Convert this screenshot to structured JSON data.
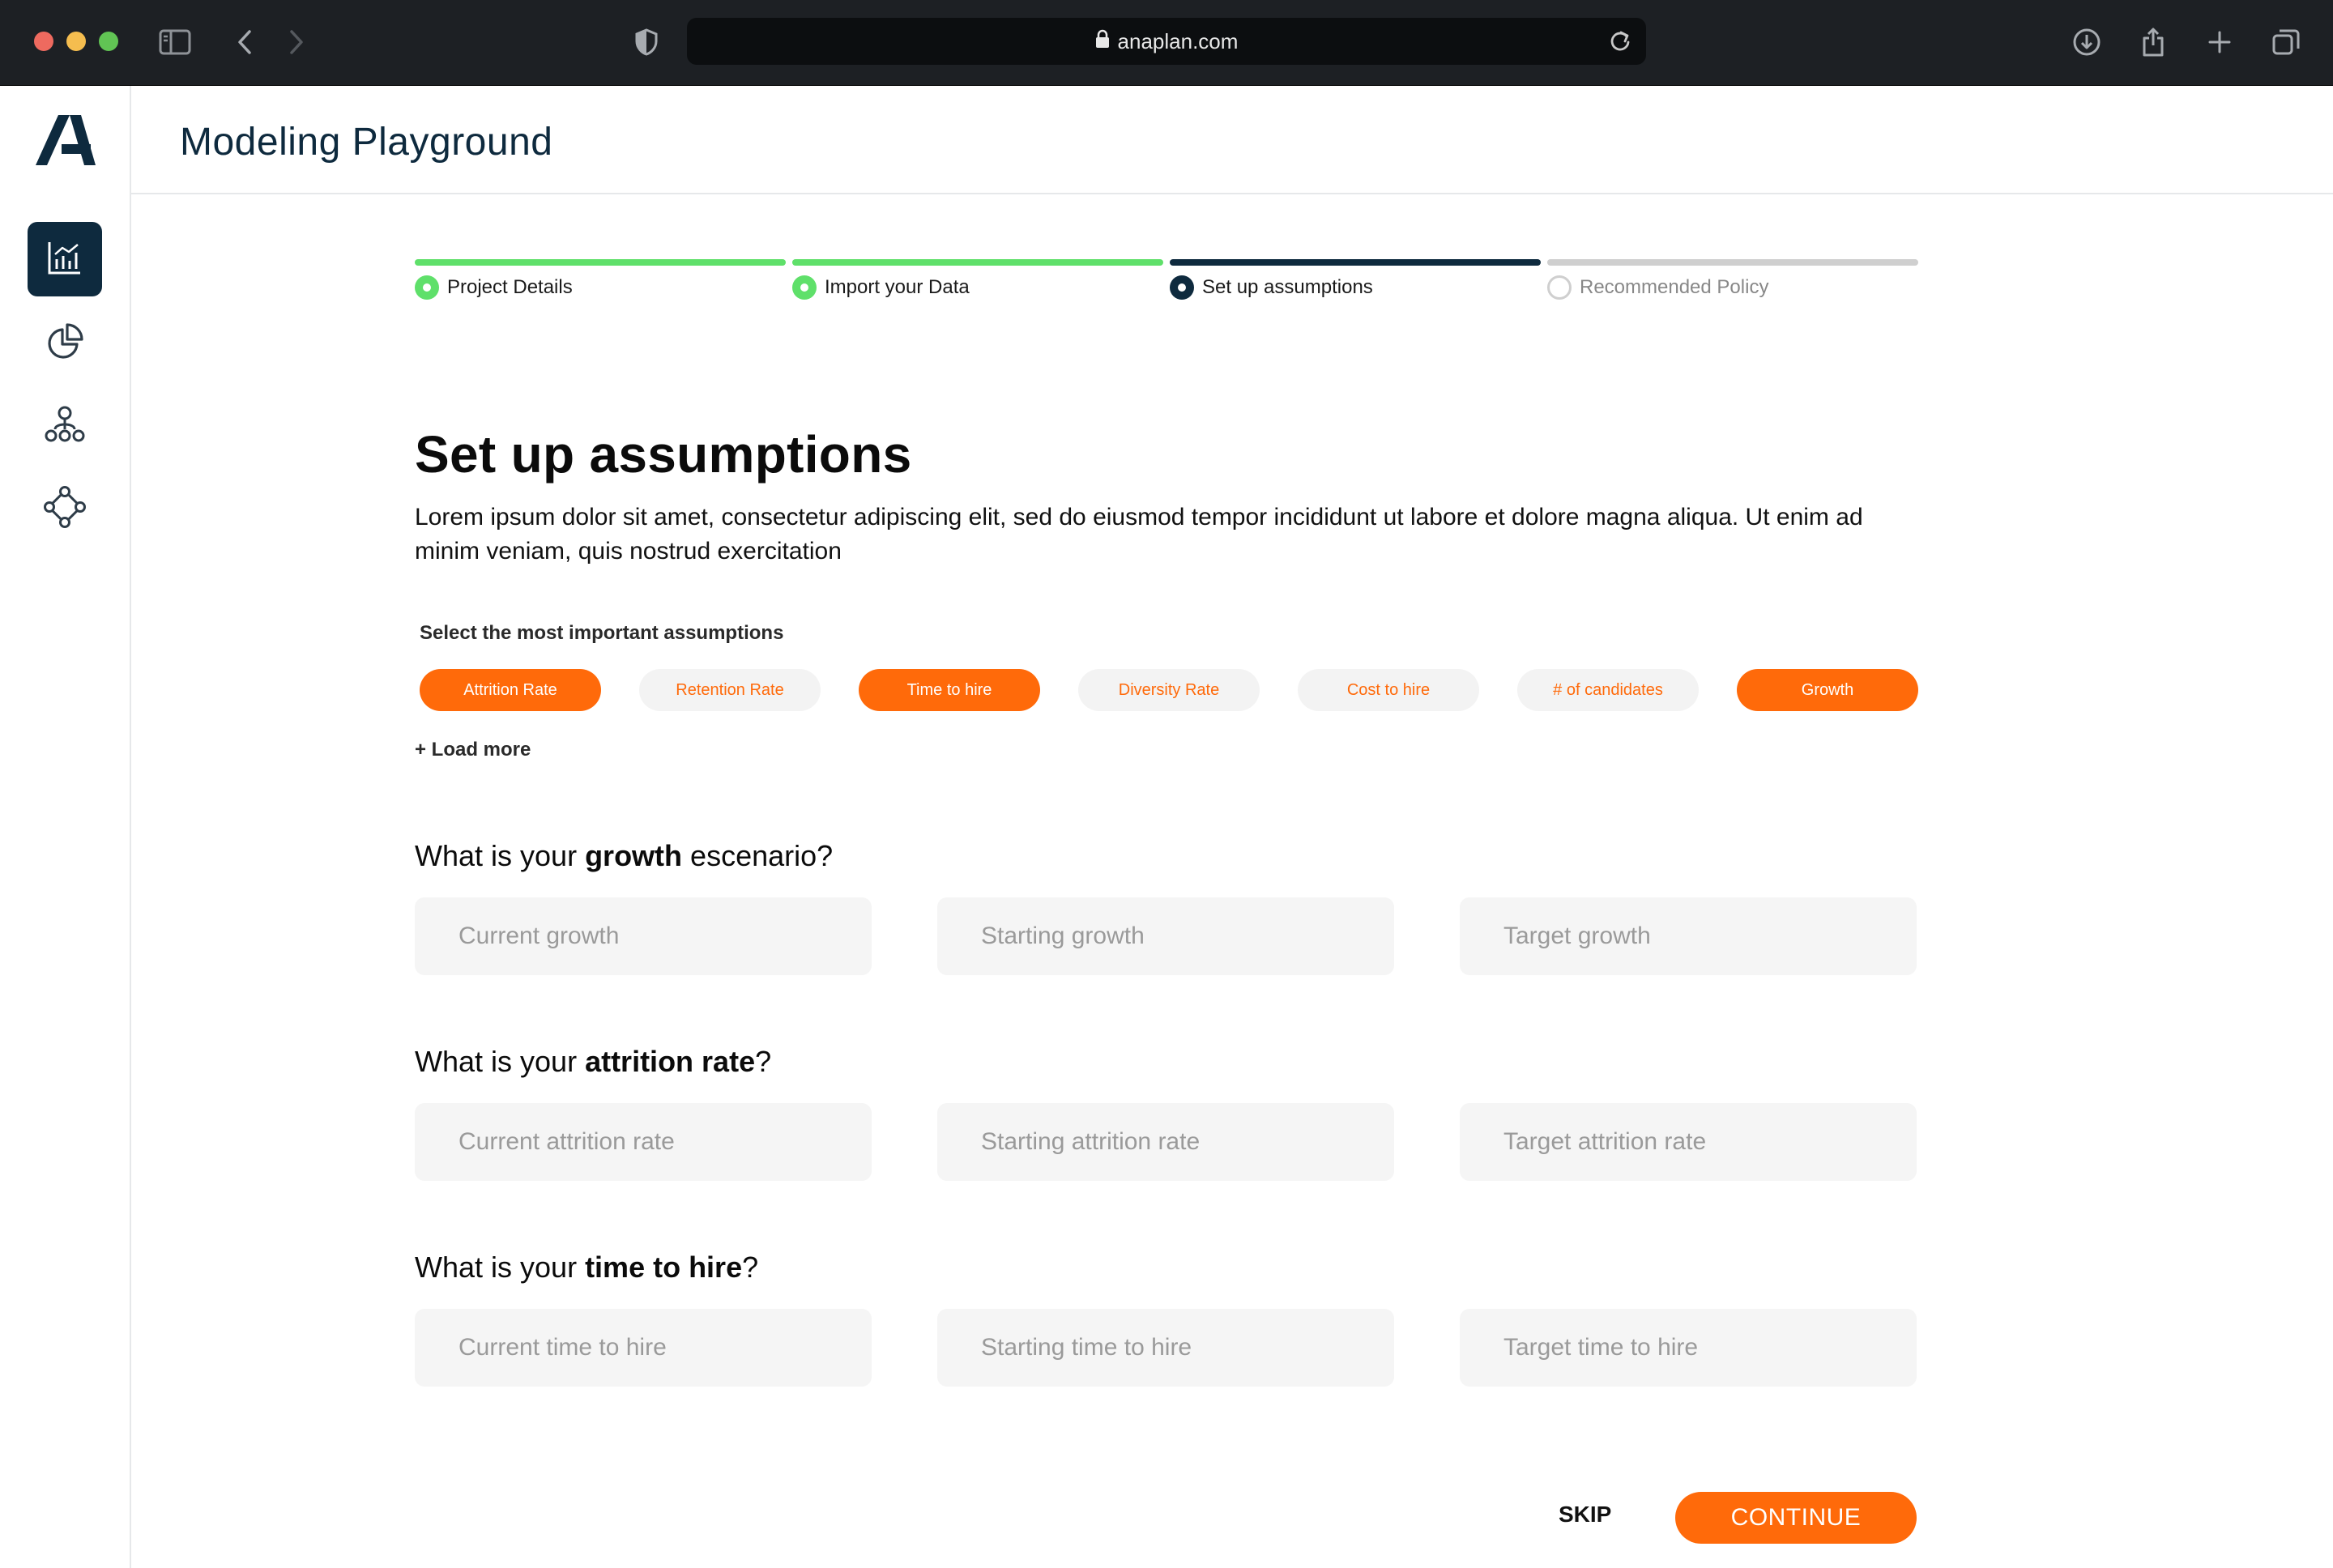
{
  "browser": {
    "url": "anaplan.com"
  },
  "app": {
    "title": "Modeling Playground"
  },
  "stepper": {
    "steps": [
      {
        "label": "Project Details",
        "state": "done"
      },
      {
        "label": "Import your Data",
        "state": "done"
      },
      {
        "label": "Set up assumptions",
        "state": "current"
      },
      {
        "label": "Recommended Policy",
        "state": "pending"
      }
    ]
  },
  "main": {
    "heading": "Set up assumptions",
    "description": "Lorem ipsum dolor sit amet, consectetur adipiscing elit, sed do eiusmod tempor incididunt ut labore et dolore magna aliqua. Ut enim ad minim veniam, quis nostrud exercitation",
    "chips_label": "Select the most important assumptions",
    "chips": [
      {
        "label": "Attrition Rate",
        "selected": true
      },
      {
        "label": "Retention Rate",
        "selected": false
      },
      {
        "label": "Time to hire",
        "selected": true
      },
      {
        "label": "Diversity Rate",
        "selected": false
      },
      {
        "label": "Cost to hire",
        "selected": false
      },
      {
        "label": "# of candidates",
        "selected": false
      },
      {
        "label": "Growth",
        "selected": true
      }
    ],
    "load_more": "+ Load more"
  },
  "questions": {
    "growth": {
      "prefix": "What is your ",
      "emphasis": "growth",
      "suffix": " escenario?",
      "placeholders": [
        "Current growth",
        "Starting growth",
        "Target growth"
      ]
    },
    "attrition": {
      "prefix": "What is your ",
      "emphasis": "attrition rate",
      "suffix": "?",
      "placeholders": [
        "Current attrition rate",
        "Starting attrition rate",
        "Target attrition rate"
      ]
    },
    "hire": {
      "prefix": "What is your ",
      "emphasis": "time to hire",
      "suffix": "?",
      "placeholders": [
        "Current time to hire",
        "Starting time to hire",
        "Target time to hire"
      ]
    }
  },
  "actions": {
    "skip": "SKIP",
    "continue": "CONTINUE"
  },
  "colors": {
    "accent": "#ff6a0a",
    "navy": "#0e2a3e",
    "success": "#5fe06a"
  },
  "icons": {
    "sidebar": [
      "analytics-chart-icon",
      "pie-chart-icon",
      "org-hierarchy-icon",
      "network-nodes-icon"
    ]
  }
}
